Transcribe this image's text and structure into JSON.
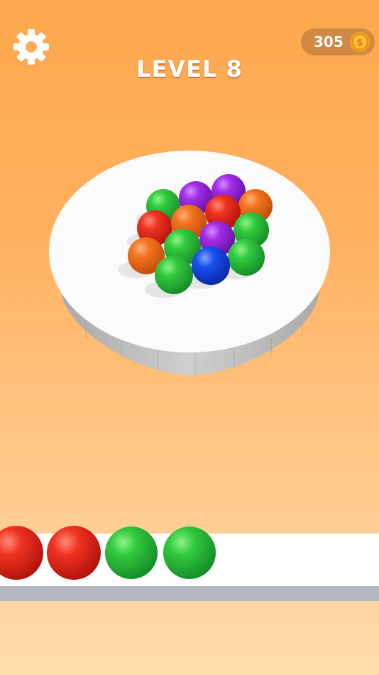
{
  "header": {
    "level_label": "LEVEL 8",
    "coins": "305",
    "coin_symbol": "$"
  },
  "icons": {
    "settings": "gear-icon",
    "coin": "coin-icon"
  },
  "colors": {
    "background_top": "#ffa84d",
    "background_bottom": "#ffdcac",
    "table_top": "#fbfbfb",
    "table_side": "#bdbdbd",
    "ball_red": "#e8261c",
    "ball_green": "#2ec43a",
    "ball_orange": "#f2701c",
    "ball_purple": "#9b25e0",
    "ball_blue": "#1348e8"
  },
  "board_balls": [
    {
      "color": "green"
    },
    {
      "color": "purple"
    },
    {
      "color": "purple"
    },
    {
      "color": "orange"
    },
    {
      "color": "red"
    },
    {
      "color": "orange"
    },
    {
      "color": "red"
    },
    {
      "color": "green"
    },
    {
      "color": "orange"
    },
    {
      "color": "green"
    },
    {
      "color": "purple"
    },
    {
      "color": "green"
    },
    {
      "color": "green"
    },
    {
      "color": "blue"
    }
  ],
  "tray_balls": [
    {
      "color": "red"
    },
    {
      "color": "red"
    },
    {
      "color": "green"
    },
    {
      "color": "green"
    }
  ]
}
